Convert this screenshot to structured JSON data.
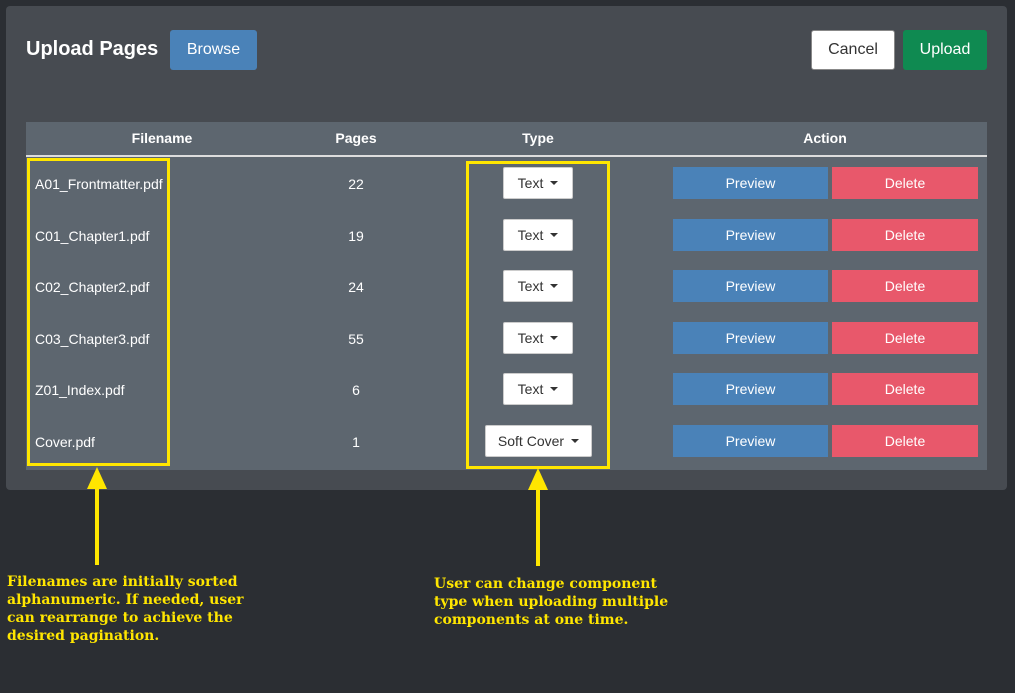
{
  "header": {
    "title": "Upload Pages",
    "browse_label": "Browse",
    "cancel_label": "Cancel",
    "upload_label": "Upload"
  },
  "table": {
    "columns": {
      "filename": "Filename",
      "pages": "Pages",
      "type": "Type",
      "action": "Action"
    },
    "rows": [
      {
        "filename": "A01_Frontmatter.pdf",
        "pages": "22",
        "type": "Text"
      },
      {
        "filename": "C01_Chapter1.pdf",
        "pages": "19",
        "type": "Text"
      },
      {
        "filename": "C02_Chapter2.pdf",
        "pages": "24",
        "type": "Text"
      },
      {
        "filename": "C03_Chapter3.pdf",
        "pages": "55",
        "type": "Text"
      },
      {
        "filename": "Z01_Index.pdf",
        "pages": "6",
        "type": "Text"
      },
      {
        "filename": "Cover.pdf",
        "pages": "1",
        "type": "Soft Cover"
      }
    ],
    "preview_label": "Preview",
    "delete_label": "Delete"
  },
  "annotations": {
    "left_note": [
      "Filenames are initially sorted",
      "alphanumeric. If needed, user",
      "can rearrange to achieve the",
      "desired pagination."
    ],
    "right_note": [
      "User can change component",
      "type when uploading multiple",
      "components at one time."
    ]
  },
  "colors": {
    "page_bg": "#2b2e33",
    "panel_bg": "#474b51",
    "table_bg": "#5d666f",
    "primary_blue": "#4a82b8",
    "upload_green": "#0f8a51",
    "delete_red": "#e8586b",
    "annotation_yellow": "#ffe600"
  }
}
